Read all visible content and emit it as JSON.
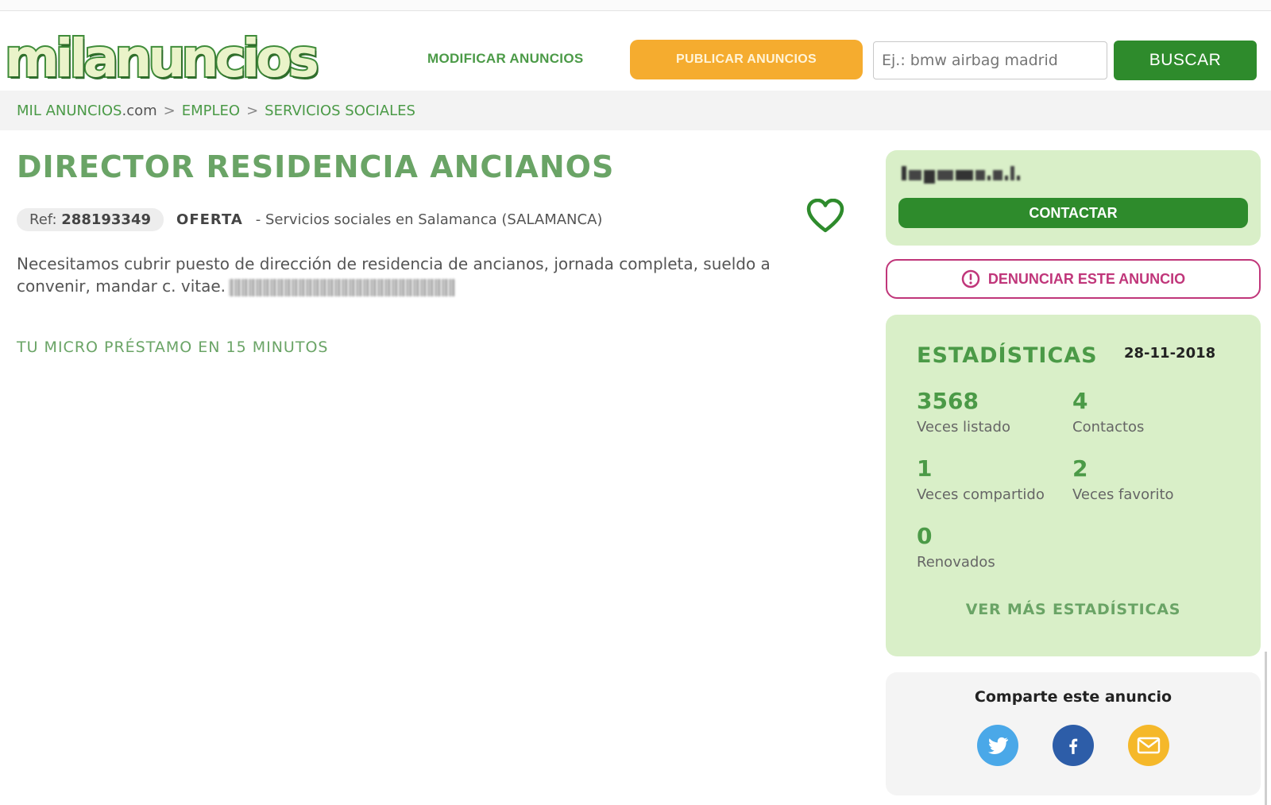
{
  "header": {
    "logo": "milanuncios",
    "nav_modificar": "MODIFICAR ANUNCIOS",
    "publicar_label": "PUBLICAR ANUNCIOS",
    "search_placeholder": "Ej.: bmw airbag madrid",
    "search_value": "",
    "buscar_label": "BUSCAR"
  },
  "breadcrumb": {
    "home": "MIL ANUNCIOS",
    "home_suffix": ".com",
    "sep": ">",
    "level1": "EMPLEO",
    "level2": "SERVICIOS SOCIALES"
  },
  "ad": {
    "title": "DIRECTOR RESIDENCIA ANCIANOS",
    "ref_label": "Ref:",
    "ref_value": "288193349",
    "type": "OFERTA",
    "category": "- Servicios sociales en Salamanca (SALAMANCA)",
    "description": "Necesitamos cubrir puesto de dirección de residencia de ancianos, jornada completa, sueldo a convenir, mandar c. vitae.",
    "promo": "TU MICRO PRÉSTAMO EN 15 MINUTOS"
  },
  "seller": {
    "contact_label": "CONTACTAR",
    "report_label": "DENUNCIAR ESTE ANUNCIO"
  },
  "stats": {
    "title": "ESTADÍSTICAS",
    "date": "28-11-2018",
    "listed": {
      "value": "3568",
      "label": "Veces listado"
    },
    "contacts": {
      "value": "4",
      "label": "Contactos"
    },
    "shared": {
      "value": "1",
      "label": "Veces compartido"
    },
    "favorite": {
      "value": "2",
      "label": "Veces favorito"
    },
    "renewed": {
      "value": "0",
      "label": "Renovados"
    },
    "more_label": "VER MÁS ESTADÍSTICAS"
  },
  "share": {
    "title": "Comparte este anuncio"
  },
  "colors": {
    "brand_green": "#2e8b2c",
    "light_green": "#d9efc8",
    "orange": "#f5ac2f",
    "report_magenta": "#c0367a"
  }
}
